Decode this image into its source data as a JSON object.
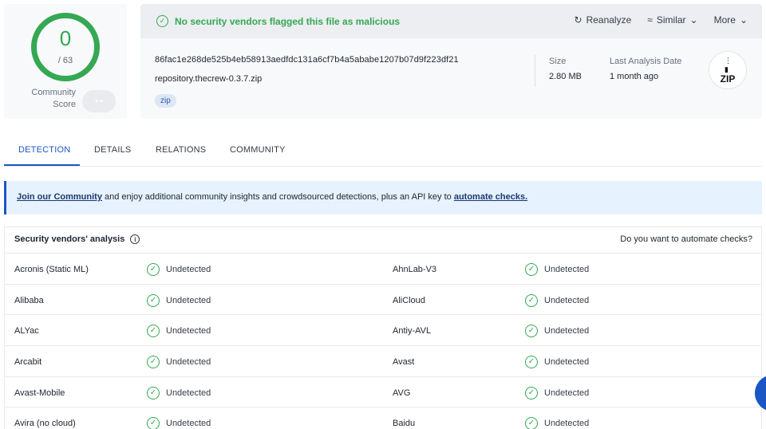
{
  "score": {
    "detections": "0",
    "total": "/ 63",
    "community_label": "Community Score",
    "community_toggle": "• •"
  },
  "summary": {
    "verdict": "No security vendors flagged this file as malicious",
    "actions": {
      "reanalyze": "Reanalyze",
      "similar": "Similar",
      "more": "More"
    },
    "hash": "86fac1e268de525b4eb58913aedfdc131a6cf7b4a5ababe1207b07d9f223df21",
    "filename": "repository.thecrew-0.3.7.zip",
    "tag": "zip",
    "size_label": "Size",
    "size_value": "2.80 MB",
    "last_analysis_label": "Last Analysis Date",
    "last_analysis_value": "1 month ago",
    "file_type_badge": "ZIP"
  },
  "tabs": [
    "DETECTION",
    "DETAILS",
    "RELATIONS",
    "COMMUNITY"
  ],
  "banner": {
    "join_link": "Join our Community",
    "text": " and enjoy additional community insights and crowdsourced detections, plus an API key to ",
    "automate_link": "automate checks."
  },
  "analysis": {
    "title": "Security vendors' analysis",
    "automate_prompt": "Do you want to automate checks?",
    "rows": [
      {
        "left_vendor": "Acronis (Static ML)",
        "left_result": "Undetected",
        "right_vendor": "AhnLab-V3",
        "right_result": "Undetected"
      },
      {
        "left_vendor": "Alibaba",
        "left_result": "Undetected",
        "right_vendor": "AliCloud",
        "right_result": "Undetected"
      },
      {
        "left_vendor": "ALYac",
        "left_result": "Undetected",
        "right_vendor": "Antiy-AVL",
        "right_result": "Undetected"
      },
      {
        "left_vendor": "Arcabit",
        "left_result": "Undetected",
        "right_vendor": "Avast",
        "right_result": "Undetected"
      },
      {
        "left_vendor": "Avast-Mobile",
        "left_result": "Undetected",
        "right_vendor": "AVG",
        "right_result": "Undetected"
      },
      {
        "left_vendor": "Avira (no cloud)",
        "left_result": "Undetected",
        "right_vendor": "Baidu",
        "right_result": "Undetected"
      }
    ]
  },
  "colors": {
    "clean_green": "#34a853",
    "accent_blue": "#1a56c4",
    "banner_bg": "#e6f2fd"
  },
  "icons": {
    "verdict": "check-circle-icon",
    "reanalyze": "refresh-icon",
    "similar": "similar-icon",
    "chevron": "chevron-down-icon",
    "info": "info-icon",
    "row_status": "check-circle-icon"
  }
}
